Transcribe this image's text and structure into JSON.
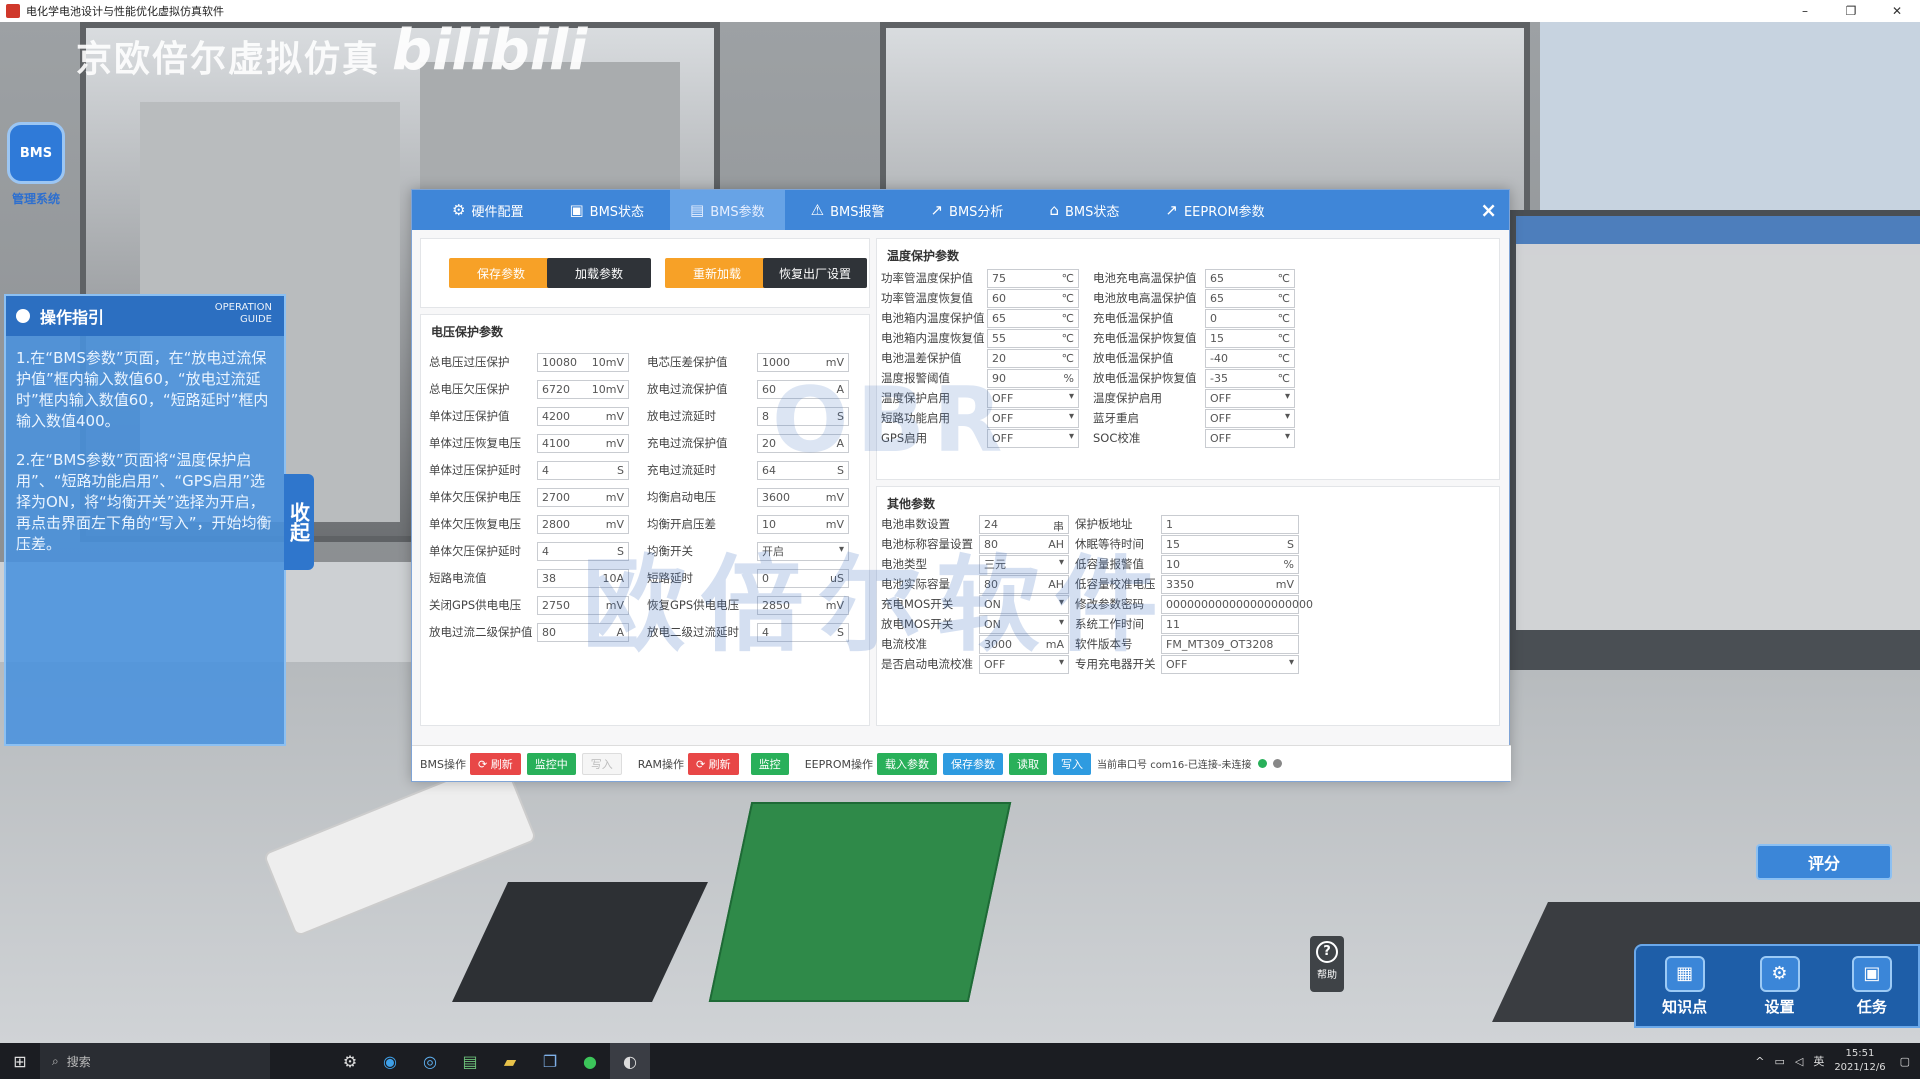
{
  "window": {
    "title": "电化学电池设计与性能优化虚拟仿真软件",
    "minimize": "–",
    "restore": "❐",
    "close": "✕"
  },
  "watermark": {
    "brand": "京欧倍尔虚拟仿真",
    "bilibili": "bilibili",
    "dialog_text": "欧倍尔软件",
    "dialog_logo": "OBR"
  },
  "left_icon": {
    "icon": "bms-icon",
    "label": "管理系统"
  },
  "guide": {
    "title": "操作指引",
    "title_en_1": "OPERATION",
    "title_en_2": "GUIDE",
    "steps": [
      "1.在“BMS参数”页面，在“放电过流保护值”框内输入数值60，“放电过流延时”框内输入数值60，“短路延时”框内输入数值400。",
      "2.在“BMS参数”页面将“温度保护启用”、“短路功能启用”、“GPS启用”选择为ON，将“均衡开关”选择为开启，再点击界面左下角的“写入”，开始均衡压差。"
    ],
    "collapse": "收起"
  },
  "dialog": {
    "tabs": [
      {
        "icon": "⚙",
        "label": "硬件配置"
      },
      {
        "icon": "▣",
        "label": "BMS状态"
      },
      {
        "icon": "▤",
        "label": "BMS参数"
      },
      {
        "icon": "⚠",
        "label": "BMS报警"
      },
      {
        "icon": "↗",
        "label": "BMS分析"
      },
      {
        "icon": "⌂",
        "label": "BMS状态"
      },
      {
        "icon": "↗",
        "label": "EEPROM参数"
      }
    ],
    "close": "×",
    "top_buttons": [
      "保存参数",
      "加载参数",
      "重新加载",
      "恢复出厂设置"
    ],
    "voltage": {
      "title": "电压保护参数",
      "left": [
        {
          "label": "总电压过压保护",
          "value": "10080",
          "unit": "10mV"
        },
        {
          "label": "总电压欠压保护",
          "value": "6720",
          "unit": "10mV"
        },
        {
          "label": "单体过压保护值",
          "value": "4200",
          "unit": "mV"
        },
        {
          "label": "单体过压恢复电压",
          "value": "4100",
          "unit": "mV"
        },
        {
          "label": "单体过压保护延时",
          "value": "4",
          "unit": "S"
        },
        {
          "label": "单体欠压保护电压",
          "value": "2700",
          "unit": "mV"
        },
        {
          "label": "单体欠压恢复电压",
          "value": "2800",
          "unit": "mV"
        },
        {
          "label": "单体欠压保护延时",
          "value": "4",
          "unit": "S"
        },
        {
          "label": "短路电流值",
          "value": "38",
          "unit": "10A"
        },
        {
          "label": "关闭GPS供电电压",
          "value": "2750",
          "unit": "mV"
        },
        {
          "label": "放电过流二级保护值",
          "value": "80",
          "unit": "A"
        }
      ],
      "right": [
        {
          "label": "电芯压差保护值",
          "value": "1000",
          "unit": "mV"
        },
        {
          "label": "放电过流保护值",
          "value": "60",
          "unit": "A"
        },
        {
          "label": "放电过流延时",
          "value": "8",
          "unit": "S"
        },
        {
          "label": "充电过流保护值",
          "value": "20",
          "unit": "A"
        },
        {
          "label": "充电过流延时",
          "value": "64",
          "unit": "S"
        },
        {
          "label": "均衡启动电压",
          "value": "3600",
          "unit": "mV"
        },
        {
          "label": "均衡开启压差",
          "value": "10",
          "unit": "mV"
        },
        {
          "label": "均衡开关",
          "value": "开启",
          "unit": "▾"
        },
        {
          "label": "短路延时",
          "value": "0",
          "unit": "uS"
        },
        {
          "label": "恢复GPS供电电压",
          "value": "2850",
          "unit": "mV"
        },
        {
          "label": "放电二级过流延时",
          "value": "4",
          "unit": "S"
        }
      ]
    },
    "temperature": {
      "title": "温度保护参数",
      "left": [
        {
          "label": "功率管温度保护值",
          "value": "75",
          "unit": "℃"
        },
        {
          "label": "功率管温度恢复值",
          "value": "60",
          "unit": "℃"
        },
        {
          "label": "电池箱内温度保护值",
          "value": "65",
          "unit": "℃"
        },
        {
          "label": "电池箱内温度恢复值",
          "value": "55",
          "unit": "℃"
        },
        {
          "label": "电池温差保护值",
          "value": "20",
          "unit": "℃"
        },
        {
          "label": "温度报警阈值",
          "value": "90",
          "unit": "%"
        },
        {
          "label": "温度保护启用",
          "value": "OFF",
          "unit": "▾"
        },
        {
          "label": "短路功能启用",
          "value": "OFF",
          "unit": "▾"
        },
        {
          "label": "GPS启用",
          "value": "OFF",
          "unit": "▾"
        }
      ],
      "right": [
        {
          "label": "电池充电高温保护值",
          "value": "65",
          "unit": "℃"
        },
        {
          "label": "电池放电高温保护值",
          "value": "65",
          "unit": "℃"
        },
        {
          "label": "充电低温保护值",
          "value": "0",
          "unit": "℃"
        },
        {
          "label": "充电低温保护恢复值",
          "value": "15",
          "unit": "℃"
        },
        {
          "label": "放电低温保护值",
          "value": "-40",
          "unit": "℃"
        },
        {
          "label": "放电低温保护恢复值",
          "value": "-35",
          "unit": "℃"
        },
        {
          "label": "温度保护启用",
          "value": "OFF",
          "unit": "▾"
        },
        {
          "label": "蓝牙重启",
          "value": "OFF",
          "unit": "▾"
        },
        {
          "label": "SOC校准",
          "value": "OFF",
          "unit": "▾"
        }
      ]
    },
    "other": {
      "title": "其他参数",
      "left": [
        {
          "label": "电池串数设置",
          "value": "24",
          "unit": "串"
        },
        {
          "label": "电池标称容量设置",
          "value": "80",
          "unit": "AH"
        },
        {
          "label": "电池类型",
          "value": "三元",
          "unit": "▾"
        },
        {
          "label": "电池实际容量",
          "value": "80",
          "unit": "AH"
        },
        {
          "label": "充电MOS开关",
          "value": "ON",
          "unit": "▾"
        },
        {
          "label": "放电MOS开关",
          "value": "ON",
          "unit": "▾"
        },
        {
          "label": "电流校准",
          "value": "3000",
          "unit": "mA"
        },
        {
          "label": "是否启动电流校准",
          "value": "OFF",
          "unit": "▾"
        }
      ],
      "right": [
        {
          "label": "保护板地址",
          "value": "1",
          "unit": ""
        },
        {
          "label": "休眠等待时间",
          "value": "15",
          "unit": "S"
        },
        {
          "label": "低容量报警值",
          "value": "10",
          "unit": "%"
        },
        {
          "label": "低容量校准电压",
          "value": "3350",
          "unit": "mV"
        },
        {
          "label": "修改参数密码",
          "value": "000000000000000000000",
          "unit": ""
        },
        {
          "label": "系统工作时间",
          "value": "11",
          "unit": ""
        },
        {
          "label": "软件版本号",
          "value": "FM_MT309_OT3208",
          "unit": ""
        },
        {
          "label": "专用充电器开关",
          "value": "OFF",
          "unit": "▾"
        }
      ]
    },
    "bottom": {
      "bms_label": "BMS操作",
      "bms_refresh": "⟳ 刷新",
      "bms_monitor": "监控中",
      "bms_write": "写入",
      "ram_label": "RAM操作",
      "ram_refresh": "⟳ 刷新",
      "ram_monitor": "监控",
      "eeprom_label": "EEPROM操作",
      "eeprom_import": "载入参数",
      "eeprom_save": "保存参数",
      "eeprom_read": "读取",
      "eeprom_write": "写入",
      "status": "当前串口号 com16-已连接-未连接"
    }
  },
  "right_ui": {
    "score": "评分",
    "tools": [
      {
        "icon": "▦",
        "label": "知识点"
      },
      {
        "icon": "⚙",
        "label": "设置"
      },
      {
        "icon": "▣",
        "label": "任务"
      }
    ],
    "help": "帮助",
    "help_icon": "?"
  },
  "taskbar": {
    "search_placeholder": "搜索",
    "time": "15:51",
    "date": "2021/12/6",
    "lang": "英"
  },
  "colors": {
    "tab_bar": "#3f86d8",
    "orange_button": "#f7a127",
    "dark_button": "#2f3338",
    "guide_panel": "#4992de"
  }
}
